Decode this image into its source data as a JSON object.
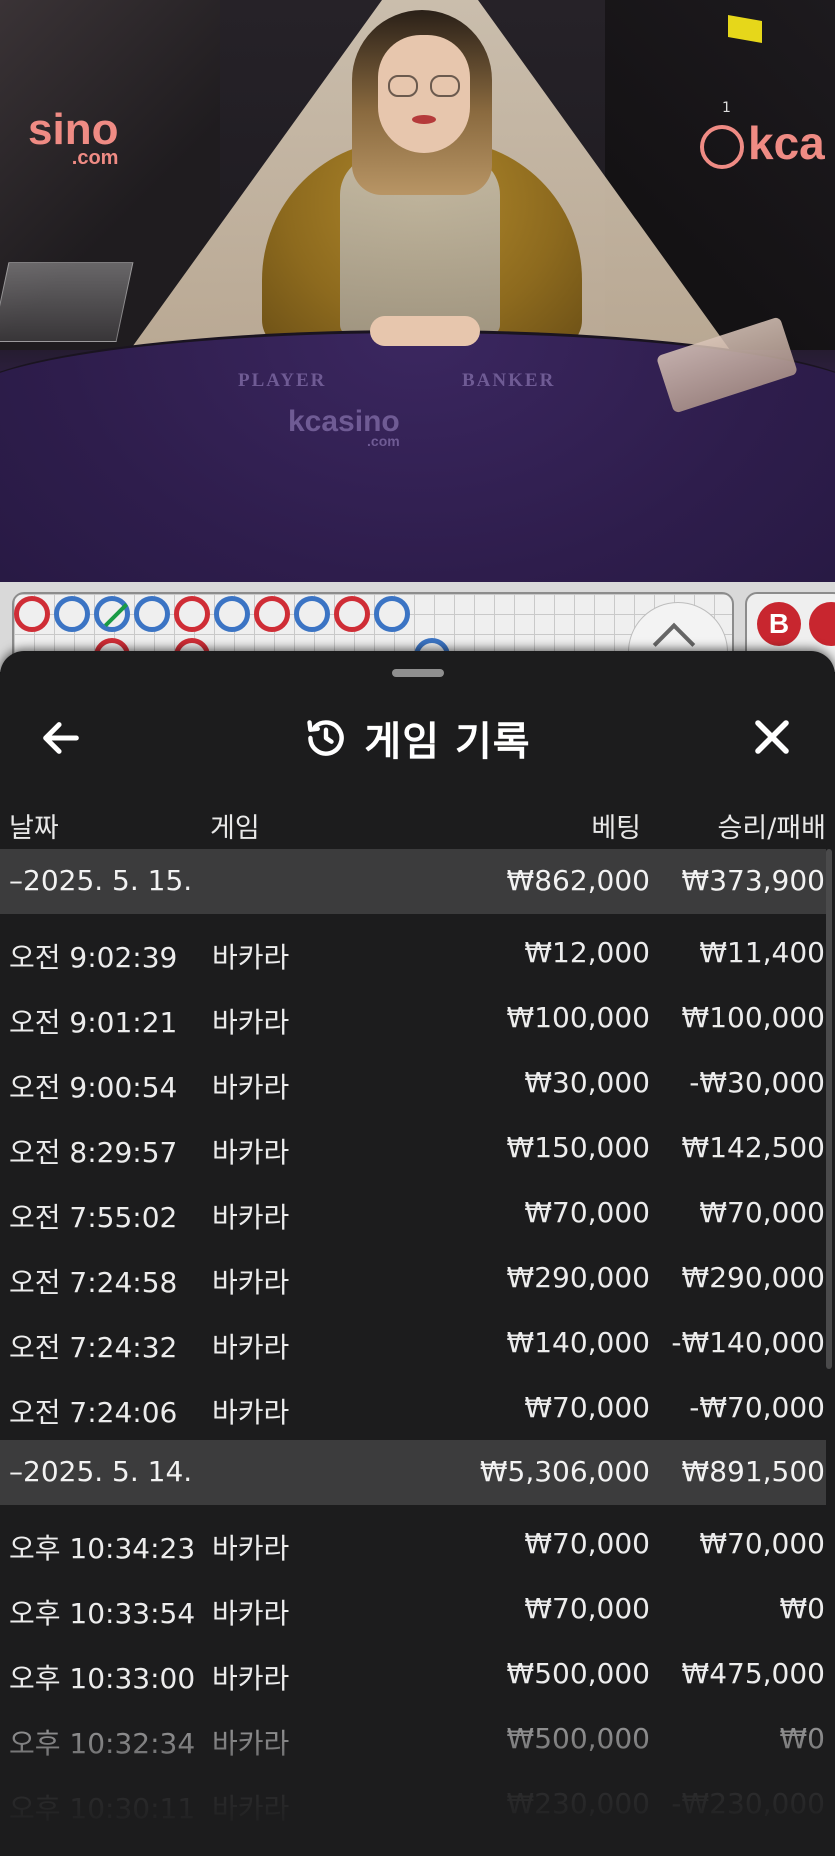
{
  "video": {
    "brand_left": "sino",
    "brand_left_sub": ".com",
    "brand_right": "kca",
    "brand_table": "kcasino",
    "brand_table_sub": ".com",
    "chip_number": "1",
    "table_label_player": "PLAYER",
    "table_label_banker": "BANKER"
  },
  "road": {
    "row1": [
      "B",
      "P",
      "P",
      "P",
      "B",
      "P",
      "B",
      "P",
      "B",
      "P"
    ],
    "badge_label": "B"
  },
  "sheet": {
    "title": "게임 기록",
    "columns": {
      "date": "날짜",
      "game": "게임",
      "bet": "베팅",
      "result": "승리/패배"
    }
  },
  "groups": [
    {
      "date": "–2025. 5. 15.",
      "bet": "₩862,000",
      "result": "₩373,900",
      "rows": [
        {
          "time": "오전 9:02:39",
          "game": "바카라",
          "bet": "₩12,000",
          "result": "₩11,400"
        },
        {
          "time": "오전 9:01:21",
          "game": "바카라",
          "bet": "₩100,000",
          "result": "₩100,000"
        },
        {
          "time": "오전 9:00:54",
          "game": "바카라",
          "bet": "₩30,000",
          "result": "-₩30,000"
        },
        {
          "time": "오전 8:29:57",
          "game": "바카라",
          "bet": "₩150,000",
          "result": "₩142,500"
        },
        {
          "time": "오전 7:55:02",
          "game": "바카라",
          "bet": "₩70,000",
          "result": "₩70,000"
        },
        {
          "time": "오전 7:24:58",
          "game": "바카라",
          "bet": "₩290,000",
          "result": "₩290,000"
        },
        {
          "time": "오전 7:24:32",
          "game": "바카라",
          "bet": "₩140,000",
          "result": "-₩140,000"
        },
        {
          "time": "오전 7:24:06",
          "game": "바카라",
          "bet": "₩70,000",
          "result": "-₩70,000"
        }
      ]
    },
    {
      "date": "–2025. 5. 14.",
      "bet": "₩5,306,000",
      "result": "₩891,500",
      "rows": [
        {
          "time": "오후 10:34:23",
          "game": "바카라",
          "bet": "₩70,000",
          "result": "₩70,000"
        },
        {
          "time": "오후 10:33:54",
          "game": "바카라",
          "bet": "₩70,000",
          "result": "₩0"
        },
        {
          "time": "오후 10:33:00",
          "game": "바카라",
          "bet": "₩500,000",
          "result": "₩475,000"
        },
        {
          "time": "오후 10:32:34",
          "game": "바카라",
          "bet": "₩500,000",
          "result": "₩0"
        },
        {
          "time": "오후 10:30:11",
          "game": "바카라",
          "bet": "₩230,000",
          "result": "-₩230,000"
        }
      ]
    }
  ],
  "colors": {
    "sheet_bg": "#1c1c1d",
    "group_header_bg": "#3c3c3d",
    "player_blue": "#3b74c4",
    "banker_red": "#cf2d36",
    "tie_green": "#1a9b45"
  }
}
